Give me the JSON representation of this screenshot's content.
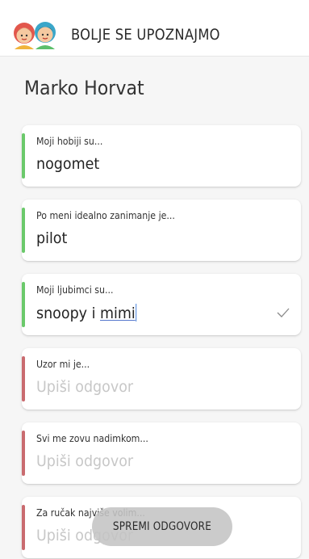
{
  "header": {
    "title": "BOLJE SE UPOZNAJMO",
    "logo_icon": "kids-faces-icon"
  },
  "profile": {
    "name": "Marko Horvat"
  },
  "questions": [
    {
      "label": "Moji hobiji su...",
      "value": "nogomet",
      "status": "answered",
      "status_color": "#6bc96b"
    },
    {
      "label": "Po meni idealno zanimanje je...",
      "value": "pilot",
      "status": "answered",
      "status_color": "#6bc96b"
    },
    {
      "label": "Moji ljubimci su...",
      "value_prefix": "snoopy i ",
      "value_underlined": "mimi",
      "status": "answered",
      "status_color": "#6bc96b",
      "focused": true
    },
    {
      "label": "Uzor mi je...",
      "placeholder": "Upiši odgovor",
      "status": "empty",
      "status_color": "#c96b6f"
    },
    {
      "label": "Svi me zovu nadimkom...",
      "placeholder": "Upiši odgovor",
      "status": "empty",
      "status_color": "#c96b6f"
    },
    {
      "label": "Za ručak najviše volim...",
      "placeholder": "Upiši odgovor",
      "status": "empty",
      "status_color": "#c96b6f"
    }
  ],
  "save_button": {
    "label": "SPREMI ODGOVORE"
  }
}
